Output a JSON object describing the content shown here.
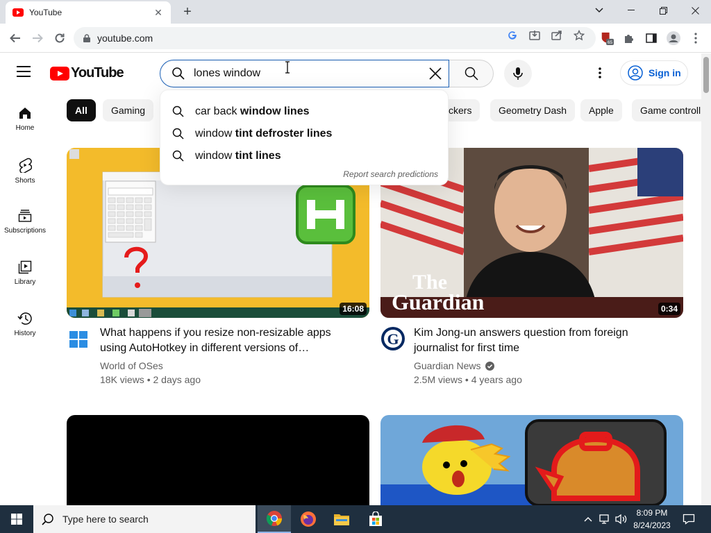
{
  "browser": {
    "tab_title": "YouTube",
    "url": "youtube.com",
    "extension_badge": "65"
  },
  "masthead": {
    "logo_text": "YouTube",
    "search_value": "lones window",
    "sign_in_label": "Sign in"
  },
  "suggestions": {
    "items": [
      {
        "normal1": "car back ",
        "bold1": "window",
        "normal2": " lines"
      },
      {
        "normal1": "",
        "bold1": "window",
        "normal2": " tint defroster lines"
      },
      {
        "normal1": "",
        "bold1": "window",
        "normal2": " tint lines"
      }
    ],
    "report_label": "Report search predictions"
  },
  "guide": {
    "items": [
      {
        "label": "Home",
        "icon": "home-icon"
      },
      {
        "label": "Shorts",
        "icon": "shorts-icon"
      },
      {
        "label": "Subscriptions",
        "icon": "subscriptions-icon"
      },
      {
        "label": "Library",
        "icon": "library-icon"
      },
      {
        "label": "History",
        "icon": "history-icon"
      }
    ]
  },
  "chips": [
    "All",
    "Gaming",
    "ckers",
    "Geometry Dash",
    "Apple",
    "Game controll"
  ],
  "videos": [
    {
      "title": "What happens if you resize non-resizable apps using AutoHotkey in different versions of…",
      "channel": "World of OSes",
      "meta": "18K views • 2 days ago",
      "duration": "16:08",
      "verified": false
    },
    {
      "title": "Kim Jong-un answers question from foreign journalist for first time",
      "channel": "Guardian News",
      "meta": "2.5M views • 4 years ago",
      "duration": "0:34",
      "verified": true,
      "thumb_watermark_1": "The",
      "thumb_watermark_2": "Guardian"
    }
  ],
  "taskbar": {
    "search_placeholder": "Type here to search",
    "time": "8:09 PM",
    "date": "8/24/2023"
  },
  "colors": {
    "youtube_red": "#ff0000",
    "link_blue": "#065fd4",
    "taskbar_bg": "#1f2f3f"
  }
}
